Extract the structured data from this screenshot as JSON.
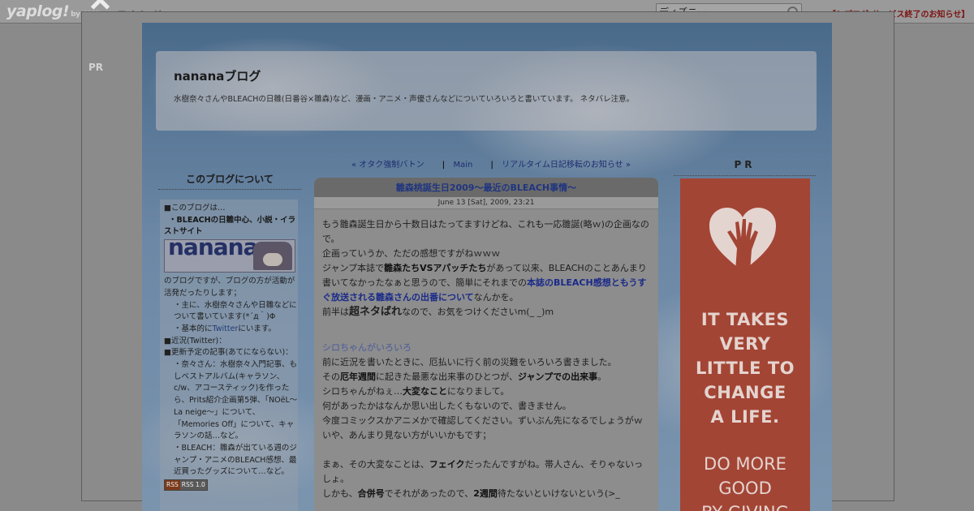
{
  "topbar": {
    "logo": "yaplog!",
    "logo_by": "by GMO",
    "mypage": "マイページ",
    "search_value": "ディズニー",
    "notice": "【ヤプログ!サービス終了のお知らせ】"
  },
  "overlay": {
    "pr_left": "PR"
  },
  "blog": {
    "title": "nananaブログ",
    "description": "水樹奈々さんやBLEACHの日雛(日番谷×雛森)など、漫画・アニメ・声優さんなどについていろいろと書いています。 ネタバレ注意。"
  },
  "sidebar": {
    "heading": "このブログについて",
    "banner_text": "nanana",
    "lines": [
      "■このブログは…",
      "・BLEACHの日雛中心、小説・イラストサイト",
      "のブログですが、ブログの方が活動が活発だったりします；",
      "・主に、水樹奈々さんや日雛などについて書いています(*´д｀)Φ",
      "・基本的に",
      "Twitter",
      "にいます。",
      "■近況(Twitter)：",
      "■更新予定の記事(あてにならない)：",
      "・奈々さん：水樹奈々入門記事、もしベストアルバム(キャラソン、c/w、アコースティック)を作ったら、Prits紹介企画第5弾、「NOëL～La neige～」について、「Memories Off」について、キャラソンの話…など。",
      "・BLEACH：雛森が出ている週のジャンプ・アニメのBLEACH感想、最近買ったグッズについて…など。"
    ],
    "rss_left": "RSS",
    "rss_right": "RSS 1.0"
  },
  "post": {
    "nav_prev": "« オタク強制バトン",
    "nav_main": "Main",
    "nav_next": "リアルタイム日記移転のお知らせ »",
    "title": "雛森桃誕生日2009～最近のBLEACH事情～",
    "date": "June 13 [Sat], 2009, 23:21",
    "body": [
      "もう雛森誕生日から十数日はたってますけどね、これも一応雛誕(略ｗ)の企画なので。",
      "企画っていうか、ただの感想ですがねｗｗｗ",
      "ジャンプ本誌で",
      "雛森たちVSアパッチたち",
      "があって以来、BLEACHのことあんまり書いてなかったなぁと思うので、簡単にそれまでの",
      "本誌のBLEACH感想ともうすぐ放送される雛森さんの出番について",
      "なんかを。",
      "前半は",
      "超ネタばれ",
      "なので、お気をつけくださいm(_ _)m",
      "シロちゃんがいろいろ",
      "前に近況を書いたときに、厄払いに行く前の災難をいろいろ書きました。",
      "その",
      "厄年週間",
      "に起きた最悪な出来事のひとつが、",
      "ジャンプでの出来事",
      "。",
      "シロちゃんがねぇ…",
      "大変なこと",
      "になりまして。",
      "何があったかはなんか思い出したくもないので、書きません。",
      "今度コミックスかアニメかで確認してください。ずいぶん先になるでしょうがｗいや、あんまり見ない方がいいかもです；",
      "まぁ、その大変なことは、",
      "フェイク",
      "だったんですがね。帯人さん、そりゃないっしょ。",
      "しかも、",
      "合併号",
      "でそれがあったので、",
      "2週間",
      "待たないといけないという(>_"
    ]
  },
  "right": {
    "pr": "PR",
    "ad_lines": [
      "IT TAKES",
      "VERY",
      "LITTLE TO",
      "CHANGE",
      "A LIFE.",
      "DO MORE",
      "GOOD",
      "BY GIVING"
    ]
  }
}
